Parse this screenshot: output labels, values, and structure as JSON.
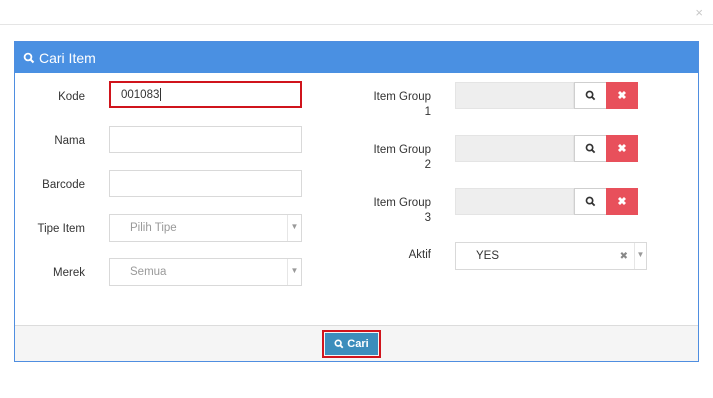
{
  "modal": {
    "close_symbol": "×"
  },
  "panel": {
    "title": "Cari Item",
    "title_icon": "search-icon"
  },
  "form": {
    "kode": {
      "label": "Kode",
      "value": "001083"
    },
    "nama": {
      "label": "Nama",
      "value": ""
    },
    "barcode": {
      "label": "Barcode",
      "value": ""
    },
    "tipe_item": {
      "label": "Tipe Item",
      "placeholder": "Pilih Tipe"
    },
    "merek": {
      "label": "Merek",
      "placeholder": "Semua"
    },
    "item_group_1": {
      "label_line1": "Item Group",
      "label_line2": "1"
    },
    "item_group_2": {
      "label_line1": "Item Group",
      "label_line2": "2"
    },
    "item_group_3": {
      "label_line1": "Item Group",
      "label_line2": "3"
    },
    "aktif": {
      "label": "Aktif",
      "value": "YES"
    }
  },
  "footer": {
    "search_label": "Cari"
  },
  "colors": {
    "header_blue": "#4a90e2",
    "highlight_red": "#d0141c",
    "clear_red": "#e8505b",
    "cari_blue": "#3c8dbc"
  }
}
